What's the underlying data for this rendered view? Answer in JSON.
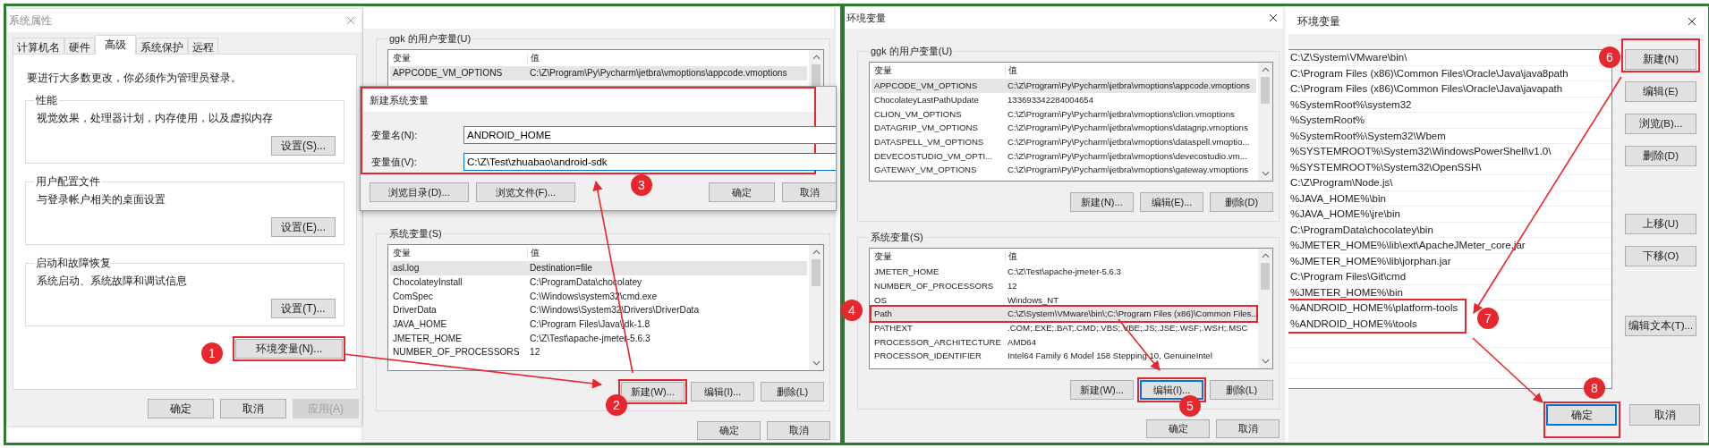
{
  "system_properties": {
    "title": "系统属性",
    "tabs": [
      {
        "label": "计算机名",
        "selected": false
      },
      {
        "label": "硬件",
        "selected": false
      },
      {
        "label": "高级",
        "selected": true
      },
      {
        "label": "系统保护",
        "selected": false
      },
      {
        "label": "远程",
        "selected": false
      }
    ],
    "notice": "要进行大多数更改，你必须作为管理员登录。",
    "groups": [
      {
        "title": "性能",
        "description": "视觉效果，处理器计划，内存使用，以及虚拟内存",
        "button": "设置(S)..."
      },
      {
        "title": "用户配置文件",
        "description": "与登录帐户相关的桌面设置",
        "button": "设置(E)..."
      },
      {
        "title": "启动和故障恢复",
        "description": "系统启动、系统故障和调试信息",
        "button": "设置(T)..."
      }
    ],
    "env_button": "环境变量(N)...",
    "buttons": [
      {
        "label": "确定",
        "disabled": false
      },
      {
        "label": "取消",
        "disabled": false
      },
      {
        "label": "应用(A)",
        "disabled": true
      }
    ]
  },
  "env_dialog_behind": {
    "user_group": "ggk 的用户变量(U)",
    "user_columns": [
      "变量",
      "值"
    ],
    "system_columns": [
      "变量",
      "值"
    ],
    "user_rows": [
      {
        "name": "APPCODE_VM_OPTIONS",
        "value": "C:\\Z\\Program\\Py\\Pycharm\\jetbra\\vmoptions\\appcode.vmoptions",
        "selected": true
      }
    ],
    "system_group": "系统变量(S)",
    "system_rows": [
      {
        "name": "asl.log",
        "value": "Destination=file",
        "selected": true
      },
      {
        "name": "ChocolateyInstall",
        "value": "C:\\ProgramData\\chocolatey",
        "selected": false
      },
      {
        "name": "ComSpec",
        "value": "C:\\Windows\\system32\\cmd.exe",
        "selected": false
      },
      {
        "name": "DriverData",
        "value": "C:\\Windows\\System32\\Drivers\\DriverData",
        "selected": false
      },
      {
        "name": "JAVA_HOME",
        "value": "C:\\Program Files\\Java\\jdk-1.8",
        "selected": false
      },
      {
        "name": "JMETER_HOME",
        "value": "C:\\Z\\Test\\apache-jmeter-5.6.3",
        "selected": false
      },
      {
        "name": "NUMBER_OF_PROCESSORS",
        "value": "12",
        "selected": false
      }
    ],
    "system_buttons": [
      {
        "label": "新建(W)...",
        "focused": false
      },
      {
        "label": "编辑(I)...",
        "focused": false
      },
      {
        "label": "删除(L)",
        "focused": false
      }
    ],
    "buttons": [
      "确定",
      "取消"
    ]
  },
  "new_variable_dialog": {
    "title": "新建系统变量",
    "fields": [
      {
        "label": "变量名(N):",
        "value": "ANDROID_HOME",
        "focused": false
      },
      {
        "label": "变量值(V):",
        "value": "C:\\Z\\Test\\zhuabao\\android-sdk",
        "focused": true
      }
    ],
    "browse_buttons": [
      "浏览目录(D)...",
      "浏览文件(F)..."
    ],
    "buttons": [
      "确定",
      "取消"
    ]
  },
  "env_dialog": {
    "title": "环境变量",
    "user_group": "ggk 的用户变量(U)",
    "user_columns": [
      "变量",
      "值"
    ],
    "system_columns": [
      "变量",
      "值"
    ],
    "user_rows": [
      {
        "name": "APPCODE_VM_OPTIONS",
        "value": "C:\\Z\\Program\\Py\\Pycharm\\jetbra\\vmoptions\\appcode.vmoptions",
        "selected": true
      },
      {
        "name": "ChocolateyLastPathUpdate",
        "value": "133693342284004654",
        "selected": false
      },
      {
        "name": "CLION_VM_OPTIONS",
        "value": "C:\\Z\\Program\\Py\\Pycharm\\jetbra\\vmoptions\\clion.vmoptions",
        "selected": false
      },
      {
        "name": "DATAGRIP_VM_OPTIONS",
        "value": "C:\\Z\\Program\\Py\\Pycharm\\jetbra\\vmoptions\\datagrip.vmoptions",
        "selected": false
      },
      {
        "name": "DATASPELL_VM_OPTIONS",
        "value": "C:\\Z\\Program\\Py\\Pycharm\\jetbra\\vmoptions\\dataspell.vmoptio...",
        "selected": false
      },
      {
        "name": "DEVECOSTUDIO_VM_OPTI...",
        "value": "C:\\Z\\Program\\Py\\Pycharm\\jetbra\\vmoptions\\devecostudio.vm...",
        "selected": false
      },
      {
        "name": "GATEWAY_VM_OPTIONS",
        "value": "C:\\Z\\Program\\Py\\Pycharm\\jetbra\\vmoptions\\gateway.vmoptions",
        "selected": false
      }
    ],
    "user_buttons": [
      "新建(N)...",
      "编辑(E)...",
      "删除(D)"
    ],
    "system_group": "系统变量(S)",
    "system_rows": [
      {
        "name": "JMETER_HOME",
        "value": "C:\\Z\\Test\\apache-jmeter-5.6.3",
        "selected": false
      },
      {
        "name": "NUMBER_OF_PROCESSORS",
        "value": "12",
        "selected": false
      },
      {
        "name": "OS",
        "value": "Windows_NT",
        "selected": false
      },
      {
        "name": "Path",
        "value": "C:\\Z\\System\\VMware\\bin\\;C:\\Program Files (x86)\\Common Files...",
        "selected": true
      },
      {
        "name": "PATHEXT",
        "value": ".COM;.EXE;.BAT;.CMD;.VBS;.VBE;.JS;.JSE;.WSF;.WSH;.MSC",
        "selected": false
      },
      {
        "name": "PROCESSOR_ARCHITECTURE",
        "value": "AMD64",
        "selected": false
      },
      {
        "name": "PROCESSOR_IDENTIFIER",
        "value": "Intel64 Family 6 Model 158 Stepping 10, GenuineIntel",
        "selected": false
      }
    ],
    "system_buttons": [
      {
        "label": "新建(W)...",
        "focused": false
      },
      {
        "label": "编辑(I)...",
        "focused": true
      },
      {
        "label": "删除(L)",
        "focused": false
      }
    ],
    "buttons": [
      "确定",
      "取消"
    ]
  },
  "edit_dialog": {
    "title": "环境变量",
    "paths": [
      "C:\\Z\\System\\VMware\\bin\\",
      "C:\\Program Files (x86)\\Common Files\\Oracle\\Java\\java8path",
      "C:\\Program Files (x86)\\Common Files\\Oracle\\Java\\javapath",
      "%SystemRoot%\\system32",
      "%SystemRoot%",
      "%SystemRoot%\\System32\\Wbem",
      "%SYSTEMROOT%\\System32\\WindowsPowerShell\\v1.0\\",
      "%SYSTEMROOT%\\System32\\OpenSSH\\",
      "C:\\Z\\Program\\Node.js\\",
      "%JAVA_HOME%\\bin",
      "%JAVA_HOME%\\jre\\bin",
      "C:\\ProgramData\\chocolatey\\bin",
      "%JMETER_HOME%\\lib\\ext\\ApacheJMeter_core.jar",
      "%JMETER_HOME%\\lib\\jorphan.jar",
      "C:\\Program Files\\Git\\cmd",
      "%JMETER_HOME%\\bin",
      "%ANDROID_HOME%\\platform-tools",
      "%ANDROID_HOME%\\tools"
    ],
    "side_buttons": [
      "新建(N)",
      "编辑(E)",
      "浏览(B)...",
      "删除(D)",
      "上移(U)",
      "下移(O)",
      "编辑文本(T)..."
    ],
    "buttons": [
      {
        "label": "确定",
        "focused": true
      },
      {
        "label": "取消",
        "focused": false
      }
    ]
  },
  "steps": [
    "1",
    "2",
    "3",
    "4",
    "5",
    "6",
    "7",
    "8"
  ]
}
